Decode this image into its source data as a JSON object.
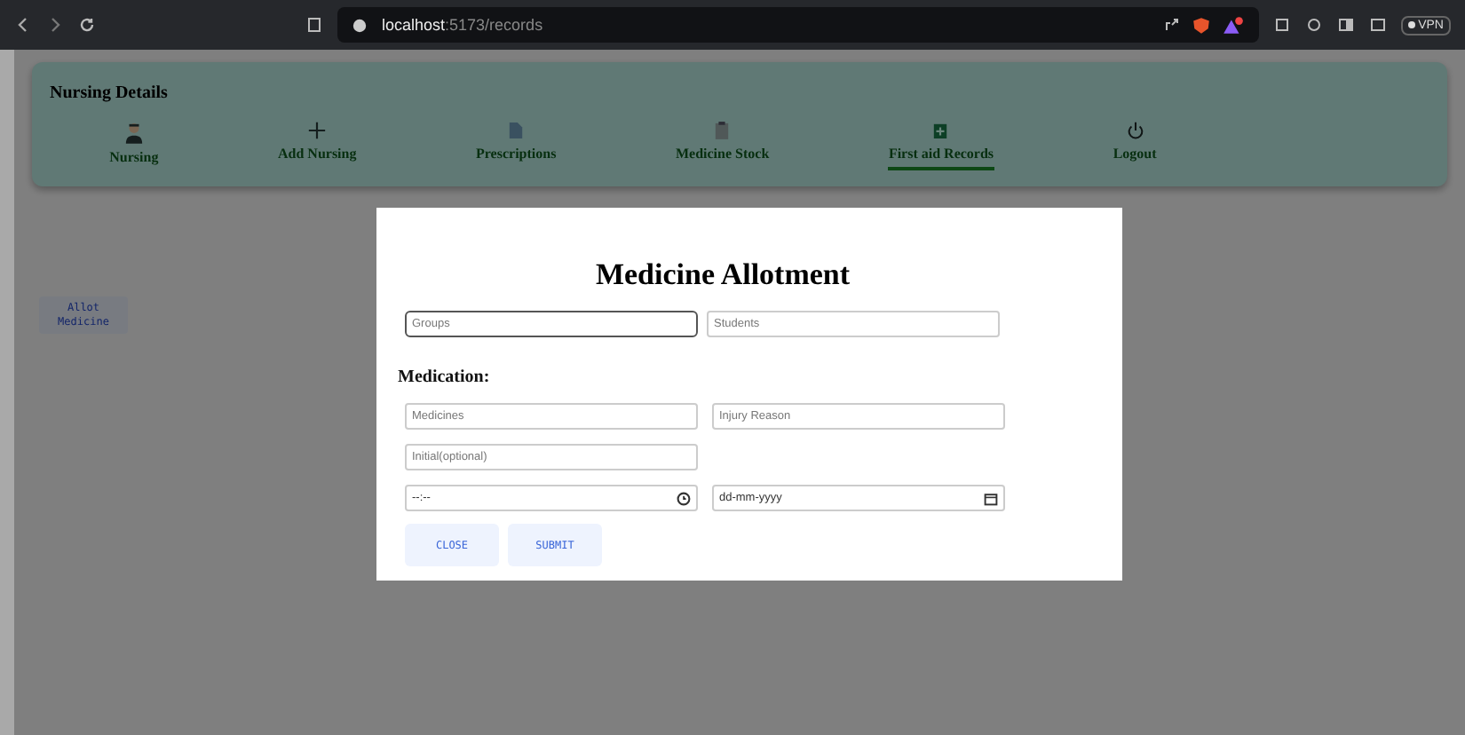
{
  "browser": {
    "host": "localhost",
    "path": ":5173/records",
    "vpn": "VPN"
  },
  "nav": {
    "title": "Nursing Details",
    "items": [
      {
        "label": "Nursing",
        "kind": "nurse",
        "selected": false
      },
      {
        "label": "Add Nursing",
        "kind": "add",
        "selected": false
      },
      {
        "label": "Prescriptions",
        "kind": "document",
        "selected": false
      },
      {
        "label": "Medicine Stock",
        "kind": "stock",
        "selected": false
      },
      {
        "label": "First aid Records",
        "kind": "records",
        "selected": true
      },
      {
        "label": "Logout",
        "kind": "logout",
        "selected": false
      }
    ]
  },
  "side_button": "Allot Medicine",
  "modal": {
    "title": "Medicine Allotment",
    "group_fields": [
      {
        "placeholder": "Groups",
        "focused": true
      },
      {
        "placeholder": "Students",
        "focused": false
      }
    ],
    "section": "Medication:",
    "medication_fields": [
      {
        "placeholder": "Medicines"
      },
      {
        "placeholder": "Injury Reason"
      }
    ],
    "initial_field": {
      "placeholder": "Initial(optional)"
    },
    "time_field": {
      "value": "--:--"
    },
    "date_field": {
      "value": "dd-mm-yyyy"
    },
    "buttons": [
      "CLOSE",
      "SUBMIT"
    ]
  }
}
